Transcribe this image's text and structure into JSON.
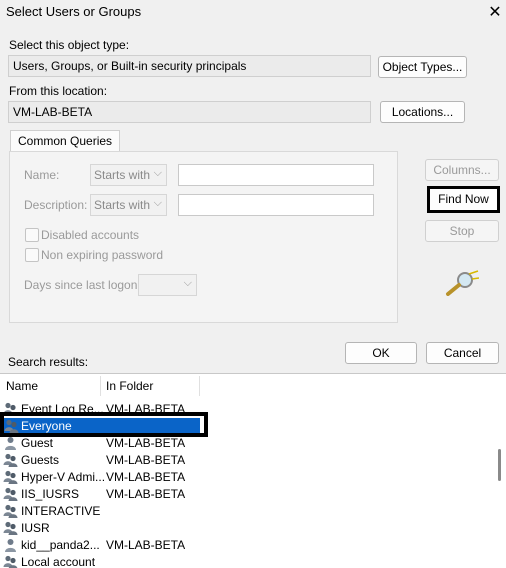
{
  "dialog": {
    "title": "Select Users or Groups"
  },
  "object_type": {
    "label": "Select this object type:",
    "value": "Users, Groups, or Built-in security principals",
    "button": "Object Types..."
  },
  "location": {
    "label": "From this location:",
    "value": "VM-LAB-BETA",
    "button": "Locations..."
  },
  "queries": {
    "tab": "Common Queries",
    "name_label": "Name:",
    "name_mode": "Starts with",
    "description_label": "Description:",
    "description_mode": "Starts with",
    "disabled_accounts": "Disabled accounts",
    "non_expiring_password": "Non expiring password",
    "days_since_logon": "Days since last logon:"
  },
  "side_buttons": {
    "columns": "Columns...",
    "find_now": "Find Now",
    "stop": "Stop"
  },
  "footer": {
    "ok": "OK",
    "cancel": "Cancel"
  },
  "results": {
    "label": "Search results:",
    "columns": [
      "Name",
      "In Folder"
    ],
    "rows": [
      {
        "name": "Event Log Re...",
        "folder": "VM-LAB-BETA",
        "icon": "group-icon"
      },
      {
        "name": "Everyone",
        "folder": "",
        "icon": "group-icon",
        "selected": true
      },
      {
        "name": "Guest",
        "folder": "VM-LAB-BETA",
        "icon": "user-icon"
      },
      {
        "name": "Guests",
        "folder": "VM-LAB-BETA",
        "icon": "group-icon"
      },
      {
        "name": "Hyper-V Admi...",
        "folder": "VM-LAB-BETA",
        "icon": "group-icon"
      },
      {
        "name": "IIS_IUSRS",
        "folder": "VM-LAB-BETA",
        "icon": "group-icon"
      },
      {
        "name": "INTERACTIVE",
        "folder": "",
        "icon": "group-icon"
      },
      {
        "name": "IUSR",
        "folder": "",
        "icon": "group-icon"
      },
      {
        "name": "kid__panda2...",
        "folder": "VM-LAB-BETA",
        "icon": "user-icon"
      },
      {
        "name": "Local account",
        "folder": "",
        "icon": "group-icon"
      }
    ]
  }
}
